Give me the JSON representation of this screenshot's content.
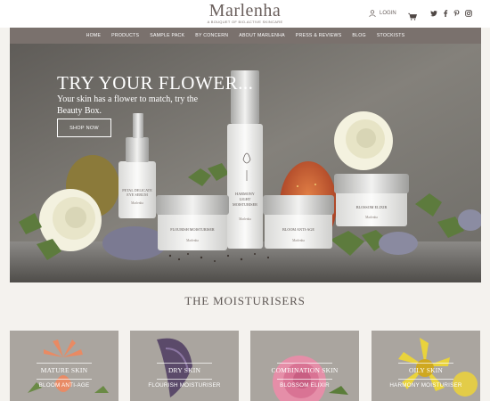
{
  "header": {
    "logo_title": "Marlenha",
    "logo_sub": "A BOUQUET OF BIO-ACTIVE SKINCARE",
    "login_label": "LOGIN",
    "icons": {
      "user": "user-icon",
      "cart": "cart-icon",
      "twitter": "twitter-icon",
      "facebook": "facebook-icon",
      "pinterest": "pinterest-icon",
      "instagram": "instagram-icon"
    }
  },
  "nav": {
    "items": [
      "HOME",
      "PRODUCTS",
      "SAMPLE PACK",
      "BY CONCERN",
      "ABOUT MARLENHA",
      "PRESS & REVIEWS",
      "BLOG",
      "STOCKISTS"
    ]
  },
  "hero": {
    "title": "TRY YOUR FLOWER...",
    "subtitle": "Your skin has a flower to match, try the Beauty Box.",
    "button": "SHOP NOW",
    "products": [
      "PETAL DELICATE EYE SERUM",
      "HARMONY LIGHT MOISTURISER",
      "FLOURISH MOISTURISER",
      "BLOOM ANTI-AGE",
      "BLOSSOM ELIXIR",
      "Marlenha"
    ]
  },
  "section": {
    "title": "THE MOISTURISERS"
  },
  "cards": [
    {
      "skin": "MATURE SKIN",
      "product": "BLOOM ANTI-AGE"
    },
    {
      "skin": "DRY SKIN",
      "product": "FLOURISH MOISTURISER"
    },
    {
      "skin": "COMBINATION SKIN",
      "product": "BLOSSOM ELIXIR"
    },
    {
      "skin": "OILY SKIN",
      "product": "HARMONY MOISTURISER"
    }
  ],
  "colors": {
    "nav_bg": "#7a716d",
    "card_bg": "#a9a49f",
    "page_bg": "#f4f2ee",
    "text": "#5b5451"
  }
}
